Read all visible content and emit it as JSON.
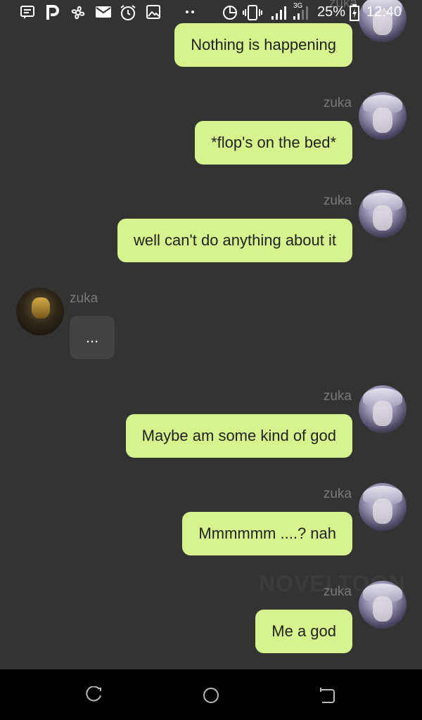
{
  "status_bar": {
    "battery": "25%",
    "time": "12:40",
    "network": "3G",
    "icons": [
      "message-icon",
      "p-icon",
      "pinwheel-icon",
      "mail-icon",
      "alarm-icon",
      "image-icon",
      "more-dots-icon",
      "data-saver-icon",
      "vibrate-icon",
      "signal-icon",
      "signal-3g-icon",
      "battery-charging-icon"
    ]
  },
  "colors": {
    "background": "#333333",
    "outgoing_bubble": "#d7f38e",
    "incoming_bubble": "#434343",
    "name": "#7a7a7a"
  },
  "top_partial_name": "zuka",
  "messages": [
    {
      "sender": "",
      "text": "Nothing is happening",
      "outgoing": true
    },
    {
      "sender": "zuka",
      "text": "*flop's on the bed*",
      "outgoing": true
    },
    {
      "sender": "zuka",
      "text": "well can't do anything about it",
      "outgoing": true
    },
    {
      "sender": "zuka",
      "text": "...",
      "outgoing": false
    },
    {
      "sender": "zuka",
      "text": "Maybe am some kind of god",
      "outgoing": true
    },
    {
      "sender": "zuka",
      "text": "Mmmmmm ....? nah",
      "outgoing": true
    },
    {
      "sender": "zuka",
      "text": "Me a god",
      "outgoing": true
    }
  ],
  "watermark": "NOVELTOON",
  "nav_bar": {
    "buttons": [
      "recent-apps-icon",
      "home-icon",
      "back-icon"
    ]
  }
}
